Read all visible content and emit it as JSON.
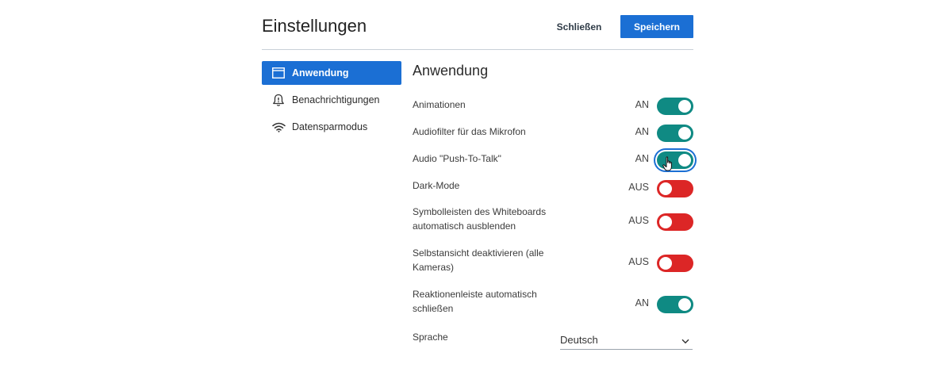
{
  "header": {
    "title": "Einstellungen",
    "close_label": "Schließen",
    "save_label": "Speichern"
  },
  "sidebar": {
    "items": [
      {
        "label": "Anwendung",
        "icon": "window-icon",
        "active": true
      },
      {
        "label": "Benachrichtigungen",
        "icon": "bell-alert-icon",
        "active": false
      },
      {
        "label": "Datensparmodus",
        "icon": "wifi-icon",
        "active": false
      }
    ]
  },
  "main": {
    "section_title": "Anwendung",
    "settings": [
      {
        "label": "Animationen",
        "state": "AN",
        "on": true
      },
      {
        "label": "Audiofilter für das Mikrofon",
        "state": "AN",
        "on": true
      },
      {
        "label": "Audio \"Push-To-Talk\"",
        "state": "AN",
        "on": true
      },
      {
        "label": "Dark-Mode",
        "state": "AUS",
        "on": false
      },
      {
        "label": "Symbolleisten des Whiteboards automatisch ausblenden",
        "state": "AUS",
        "on": false
      },
      {
        "label": "Selbstansicht deaktivieren (alle Kameras)",
        "state": "AUS",
        "on": false
      },
      {
        "label": "Reaktionenleiste automatisch schließen",
        "state": "AN",
        "on": true
      }
    ],
    "language": {
      "label": "Sprache",
      "value": "Deutsch"
    }
  },
  "colors": {
    "accent": "#1b6fd4",
    "toggle_on": "#0f8a83",
    "toggle_off": "#dc2626"
  }
}
